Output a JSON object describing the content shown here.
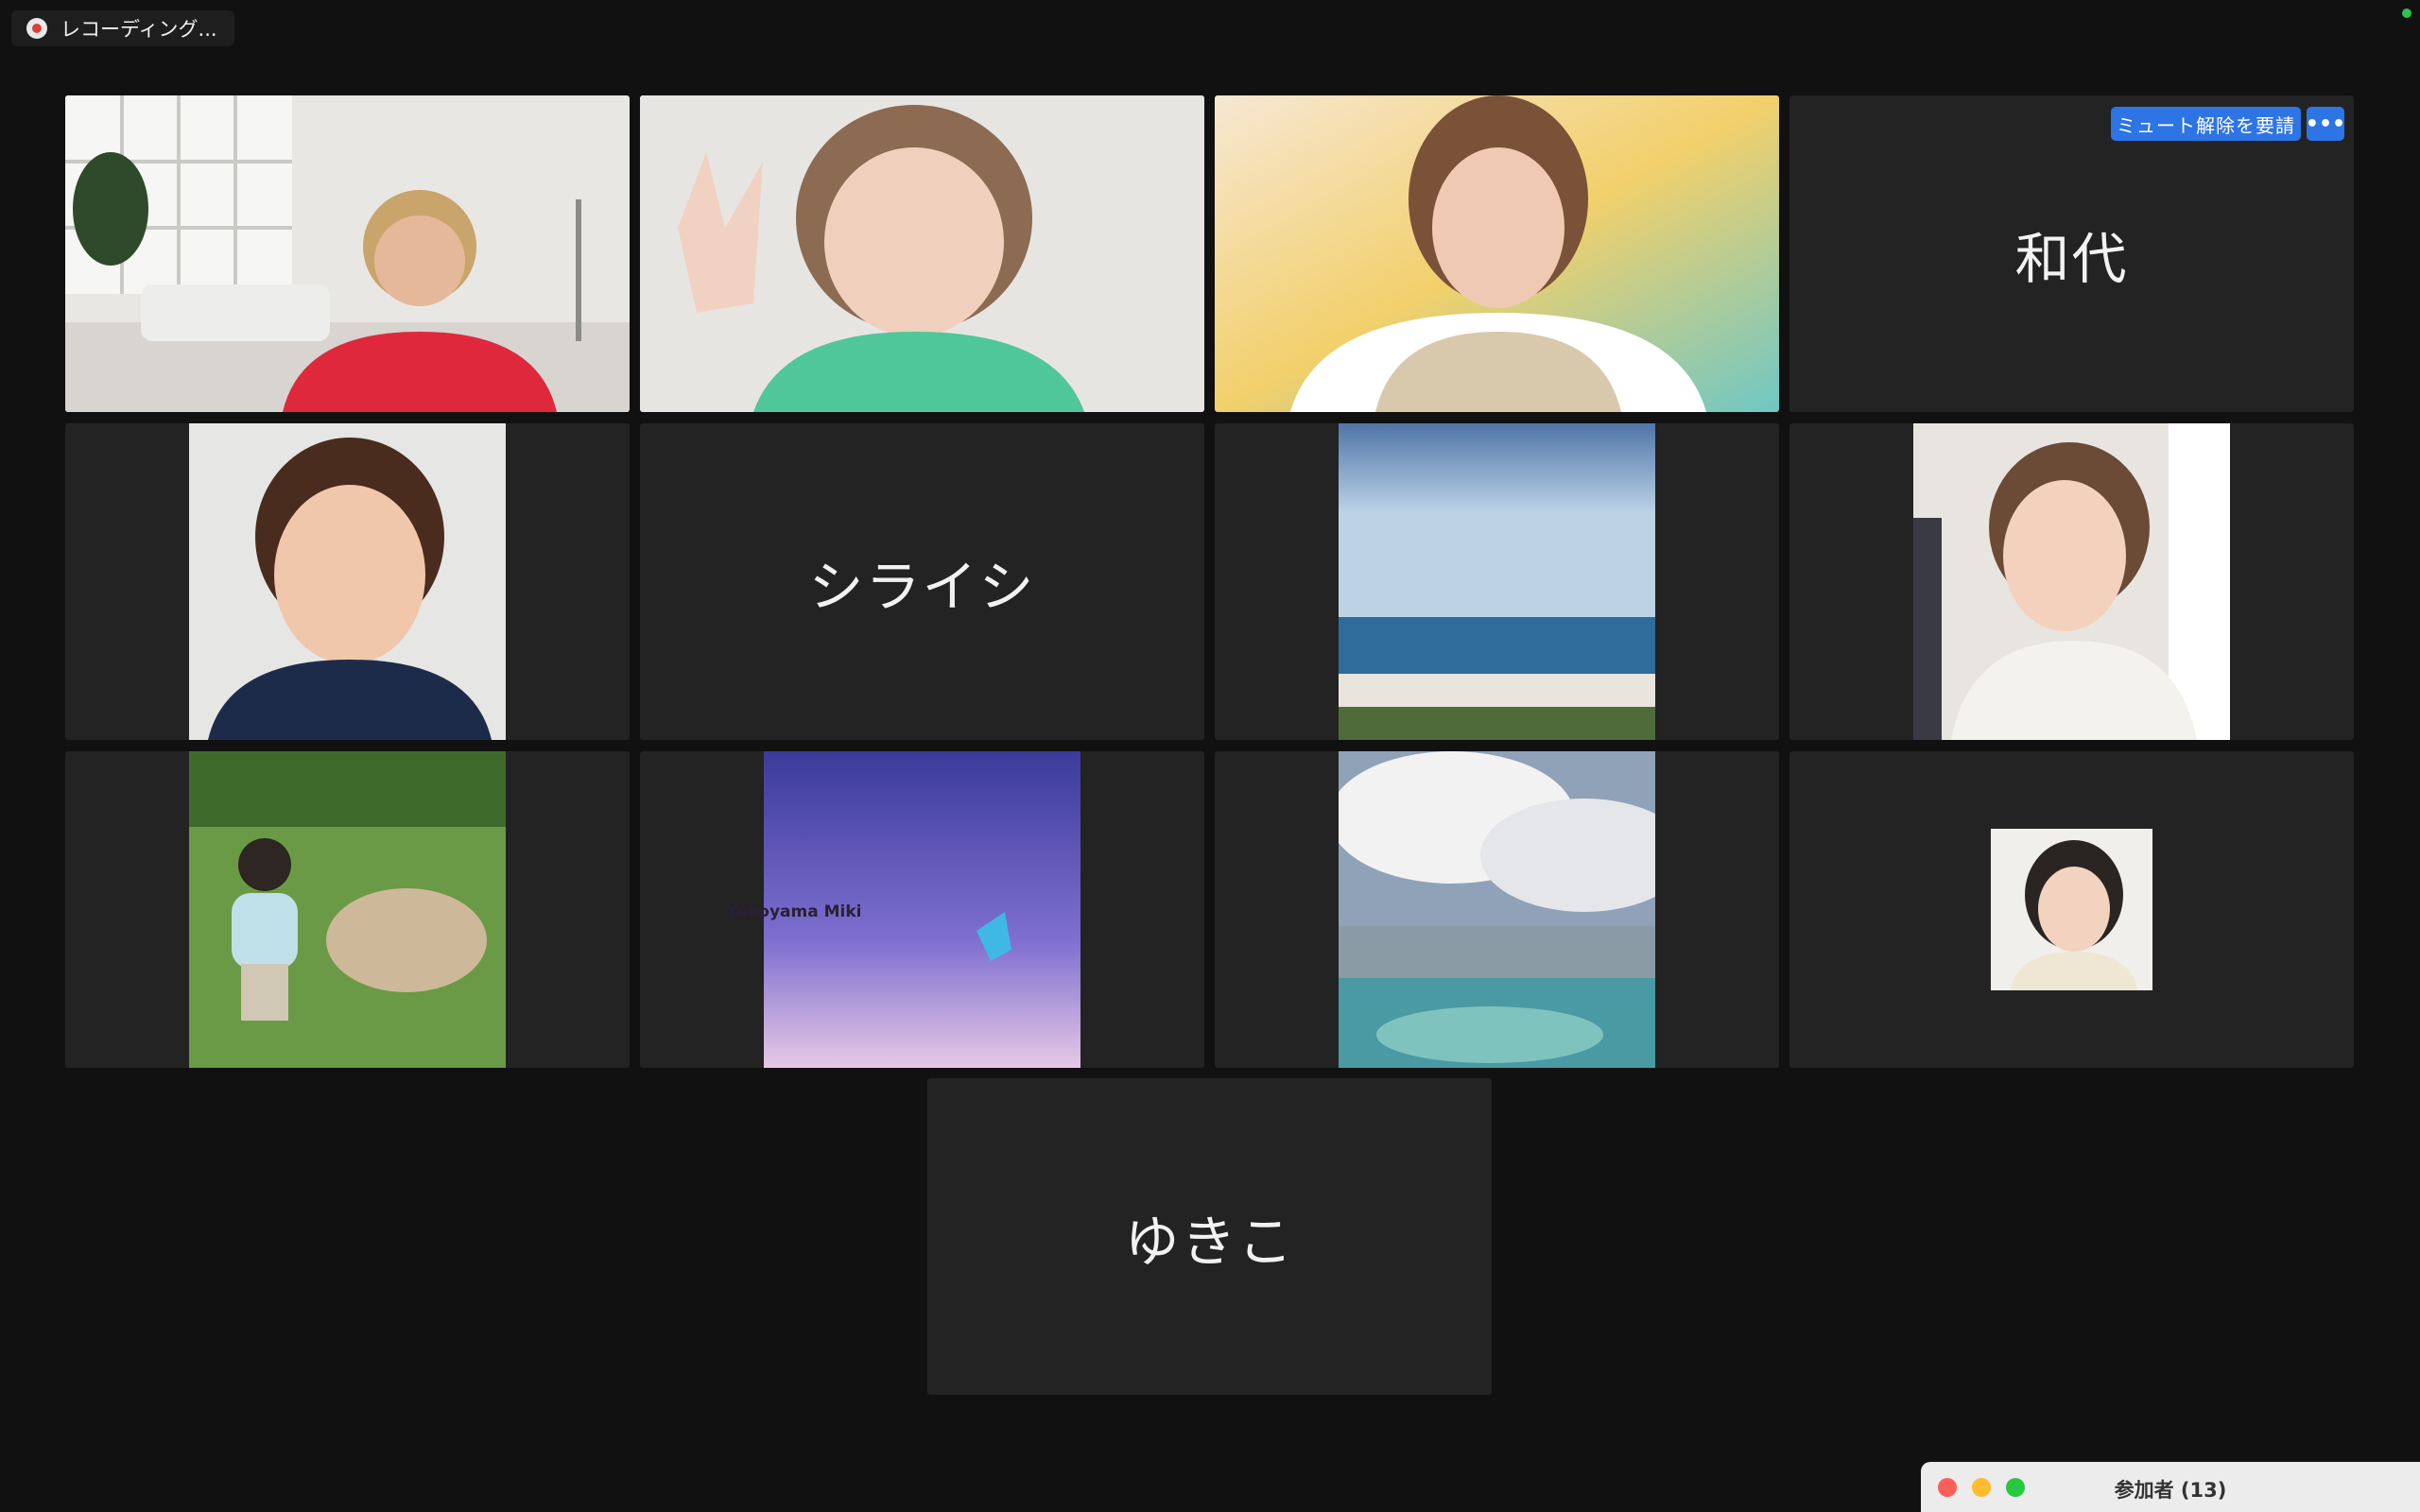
{
  "recording": {
    "label": "レコーディング..."
  },
  "tiles": {
    "t4": {
      "name": "和代",
      "unmute_label": "ミュート解除を要請",
      "more_label": "•••"
    },
    "t6": {
      "name": "シライシ"
    },
    "t10": {
      "overlay": "Yokoyama Miki"
    },
    "t13": {
      "name": "ゆきこ"
    }
  },
  "participants_panel": {
    "title": "参加者 (13)"
  },
  "colors": {
    "active_border": "#3ecf4a",
    "button_blue": "#2d74e5",
    "tile_bg": "#232323",
    "bg": "#111111"
  }
}
